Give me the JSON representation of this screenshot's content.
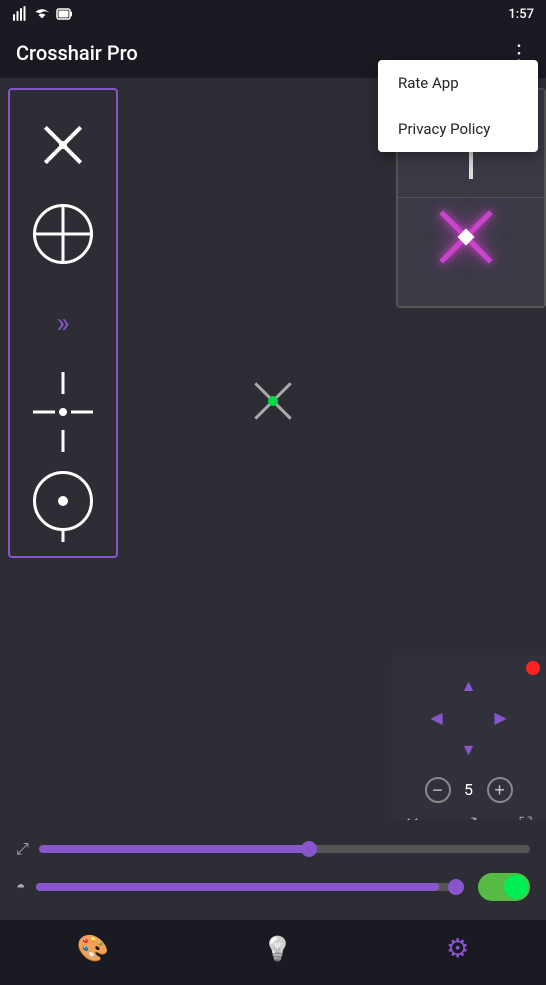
{
  "app": {
    "title": "Crosshair Pro",
    "time": "1:57"
  },
  "menu": {
    "items": [
      {
        "label": "Rate App",
        "id": "rate-app"
      },
      {
        "label": "Privacy Policy",
        "id": "privacy-policy"
      }
    ]
  },
  "controls": {
    "stepper_value": "5",
    "stepper_minus": "−",
    "stepper_plus": "+"
  },
  "sliders": {
    "size_icon": "⤢",
    "opacity_icon": "◓"
  },
  "nav": {
    "items": [
      {
        "icon": "🎨",
        "label": "palette",
        "active": false
      },
      {
        "icon": "💡",
        "label": "light",
        "active": false
      },
      {
        "icon": "⚙",
        "label": "settings",
        "active": false
      }
    ]
  }
}
